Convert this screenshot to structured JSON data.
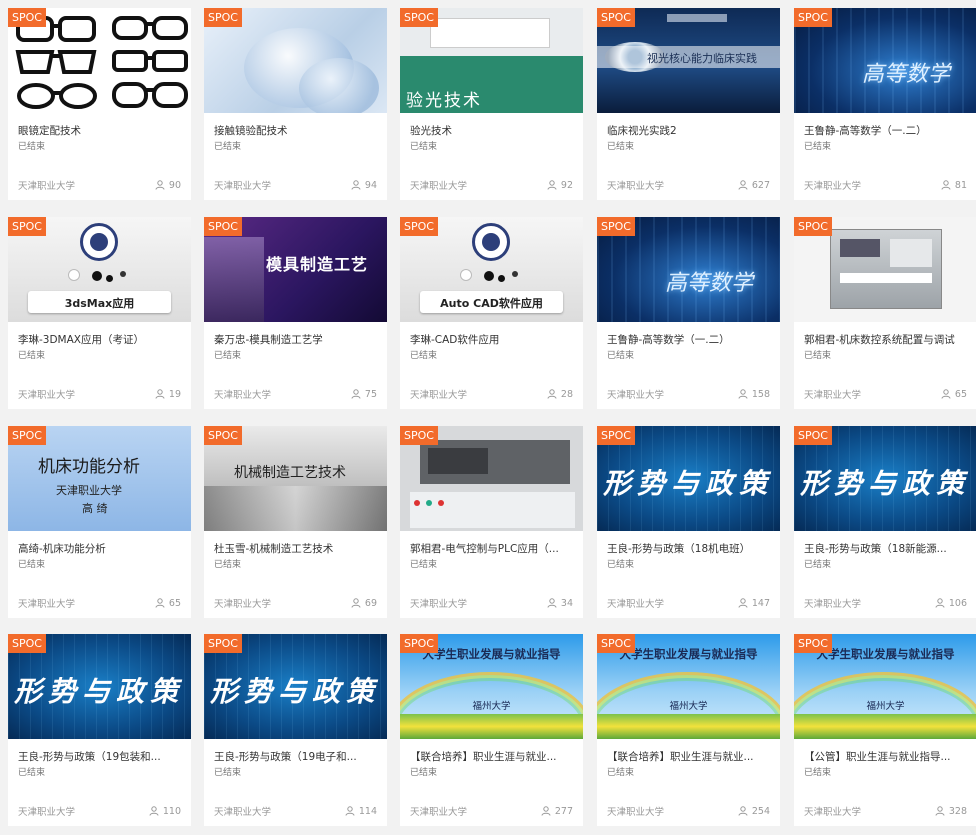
{
  "accent": "#f26b2b",
  "tag": "SPOC",
  "cards": [
    {
      "title": "眼镜定配技术",
      "status": "已结束",
      "school": "天津职业大学",
      "count": "90",
      "thumb": "glasses"
    },
    {
      "title": "接触镜验配技术",
      "status": "已结束",
      "school": "天津职业大学",
      "count": "94",
      "thumb": "lens"
    },
    {
      "title": "验光技术",
      "status": "已结束",
      "school": "天津职业大学",
      "count": "92",
      "thumb": "book",
      "thumb_text": "验光技术"
    },
    {
      "title": "临床视光实践2",
      "status": "已结束",
      "school": "天津职业大学",
      "count": "627",
      "thumb": "eye",
      "thumb_text": "视光核心能力临床实践"
    },
    {
      "title": "王鲁静-高等数学（一.二）",
      "status": "已结束",
      "school": "天津职业大学",
      "count": "81",
      "thumb": "math",
      "thumb_text": "高等数学"
    },
    {
      "title": "李琳-3DMAX应用（考证）",
      "status": "已结束",
      "school": "天津职业大学",
      "count": "19",
      "thumb": "logo",
      "thumb_text": "3dsMax应用"
    },
    {
      "title": "秦万忠-模具制造工艺学",
      "status": "已结束",
      "school": "天津职业大学",
      "count": "75",
      "thumb": "mold",
      "thumb_text": "模具制造工艺"
    },
    {
      "title": "李琳-CAD软件应用",
      "status": "已结束",
      "school": "天津职业大学",
      "count": "28",
      "thumb": "logo",
      "thumb_text": "Auto CAD软件应用"
    },
    {
      "title": "王鲁静-高等数学（一.二）",
      "status": "已结束",
      "school": "天津职业大学",
      "count": "158",
      "thumb": "math",
      "thumb_text": "高等数学"
    },
    {
      "title": "郭相君-机床数控系统配置与调试",
      "status": "已结束",
      "school": "天津职业大学",
      "count": "65",
      "thumb": "machine"
    },
    {
      "title": "高绮-机床功能分析",
      "status": "已结束",
      "school": "天津职业大学",
      "count": "65",
      "thumb": "analysis",
      "thumb_text": "机床功能分析",
      "thumb_sub": "天津职业大学",
      "thumb_sub2": "高 绮"
    },
    {
      "title": "杜玉雪-机械制造工艺技术",
      "status": "已结束",
      "school": "天津职业大学",
      "count": "69",
      "thumb": "mech",
      "thumb_text": "机械制造工艺技术"
    },
    {
      "title": "郭相君-电气控制与PLC应用（...",
      "status": "已结束",
      "school": "天津职业大学",
      "count": "34",
      "thumb": "plc"
    },
    {
      "title": "王良-形势与政策（18机电班）",
      "status": "已结束",
      "school": "天津职业大学",
      "count": "147",
      "thumb": "policy",
      "thumb_text": "形势与政策"
    },
    {
      "title": "王良-形势与政策（18新能源...",
      "status": "已结束",
      "school": "天津职业大学",
      "count": "106",
      "thumb": "policy",
      "thumb_text": "形势与政策"
    },
    {
      "title": "王良-形势与政策（19包装和...",
      "status": "已结束",
      "school": "天津职业大学",
      "count": "110",
      "thumb": "policy",
      "thumb_text": "形势与政策"
    },
    {
      "title": "王良-形势与政策（19电子和...",
      "status": "已结束",
      "school": "天津职业大学",
      "count": "114",
      "thumb": "policy",
      "thumb_text": "形势与政策"
    },
    {
      "title": "【联合培养】职业生涯与就业...",
      "status": "已结束",
      "school": "天津职业大学",
      "count": "277",
      "thumb": "career",
      "thumb_text": "大学生职业发展与就业指导",
      "thumb_sub": "福州大学"
    },
    {
      "title": "【联合培养】职业生涯与就业...",
      "status": "已结束",
      "school": "天津职业大学",
      "count": "254",
      "thumb": "career",
      "thumb_text": "大学生职业发展与就业指导",
      "thumb_sub": "福州大学"
    },
    {
      "title": "【公管】职业生涯与就业指导...",
      "status": "已结束",
      "school": "天津职业大学",
      "count": "328",
      "thumb": "career",
      "thumb_text": "大学生职业发展与就业指导",
      "thumb_sub": "福州大学"
    }
  ]
}
